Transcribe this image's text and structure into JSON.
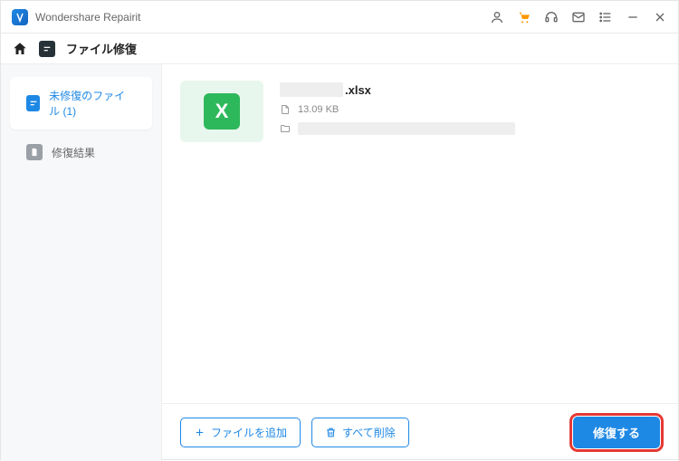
{
  "app": {
    "title": "Wondershare Repairit"
  },
  "titlebar_icons": {
    "user": "user",
    "cart": "cart",
    "headset": "headset",
    "mail": "mail",
    "menu": "menu",
    "min": "minimize",
    "close": "close"
  },
  "breadcrumb": {
    "label": "ファイル修復"
  },
  "sidebar": {
    "items": [
      {
        "label": "未修復のファイル (1)",
        "active": true
      },
      {
        "label": "修復結果",
        "active": false
      }
    ]
  },
  "file": {
    "ext": ".xlsx",
    "size": "13.09 KB"
  },
  "footer": {
    "add_label": "ファイルを追加",
    "clear_label": "すべて削除",
    "repair_label": "修復する"
  }
}
